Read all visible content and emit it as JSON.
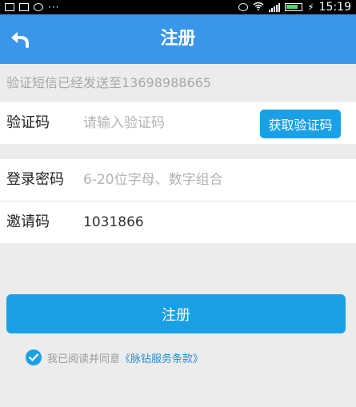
{
  "status_bar": {
    "time": "15:19"
  },
  "header": {
    "title": "注册",
    "back_icon": "back-arrow-icon"
  },
  "notice": "验证短信已经发送至13698988665",
  "form": {
    "verify_code": {
      "label": "验证码",
      "placeholder": "请输入验证码",
      "value": "",
      "button": "获取验证码"
    },
    "password": {
      "label": "登录密码",
      "placeholder": "6-20位字母、数字组合",
      "value": ""
    },
    "invite": {
      "label": "邀请码",
      "value": "1031866"
    }
  },
  "submit_label": "注册",
  "agreement": {
    "checked": true,
    "text": "我已阅读并同意",
    "link": "《脉钻服务条款》"
  },
  "colors": {
    "primary": "#3a96ea",
    "button": "#1aa0e6",
    "background": "#ececec"
  }
}
